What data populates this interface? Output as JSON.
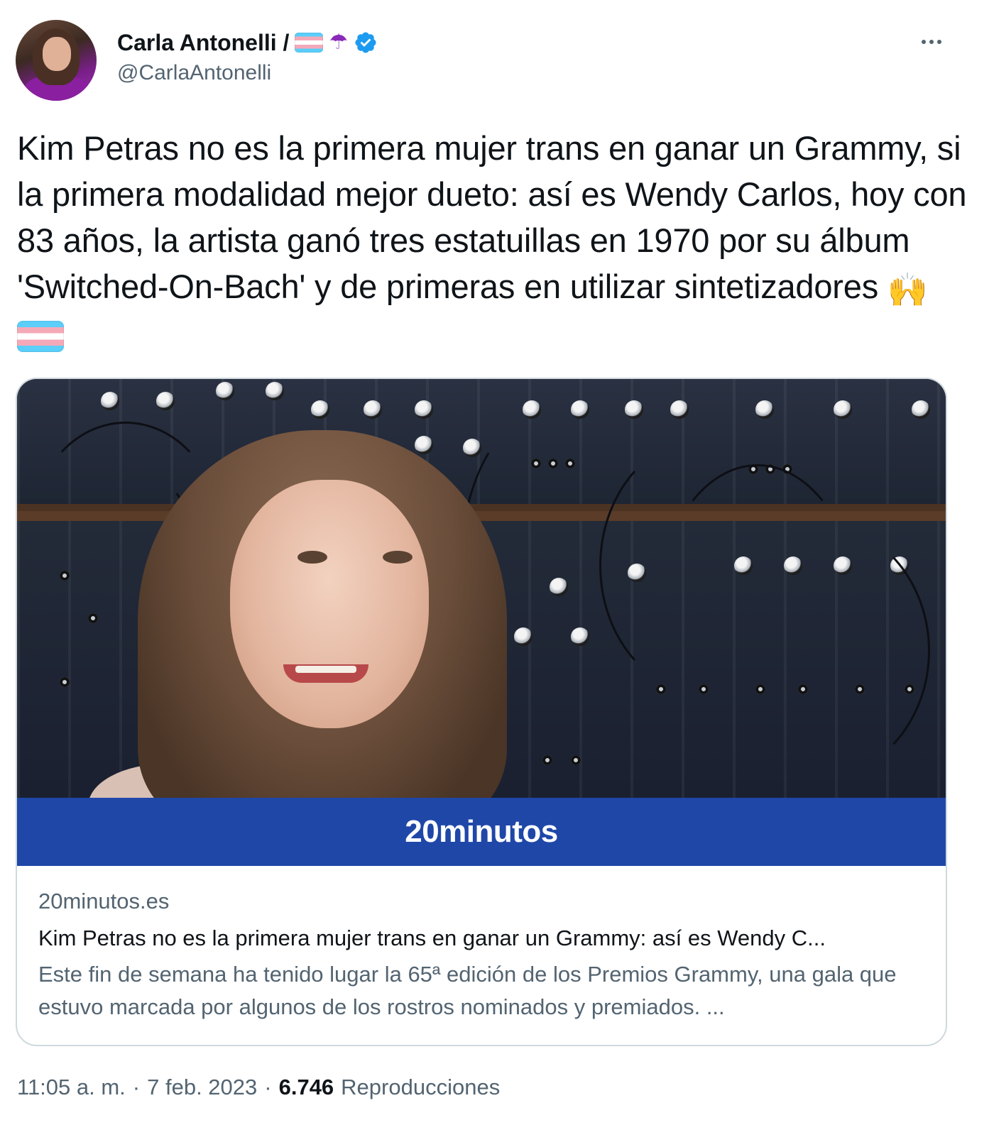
{
  "author": {
    "name": "Carla Antonelli /",
    "handle": "@CarlaAntonelli",
    "umbrella_emoji": "☂"
  },
  "tweet": {
    "text": "Kim Petras no es la primera mujer trans en ganar un Grammy, si la primera modalidad mejor dueto: así es Wendy Carlos, hoy con 83 años, la artista ganó tres estatuillas en 1970 por su álbum 'Switched-On-Bach' y de primeras en utilizar sintetizadores",
    "hands_emoji": "🙌"
  },
  "card": {
    "banner": "20minutos",
    "domain": "20minutos.es",
    "title": "Kim Petras no es la primera mujer trans en ganar un Grammy: así es Wendy C...",
    "description": "Este fin de semana ha tenido lugar la 65ª edición de los Premios Grammy, una gala que estuvo marcada por algunos de los rostros nominados y premiados. ..."
  },
  "footer": {
    "time": "11:05 a. m.",
    "sep1": "·",
    "date": "7 feb. 2023",
    "sep2": "·",
    "views": "6.746",
    "views_label": "Reproducciones"
  },
  "colors": {
    "banner": "#1f47a8",
    "verified": "#1d9bf0",
    "secondary_text": "#536471"
  },
  "icons": {
    "verified": "verified-badge-icon",
    "more": "more-options-icon"
  }
}
